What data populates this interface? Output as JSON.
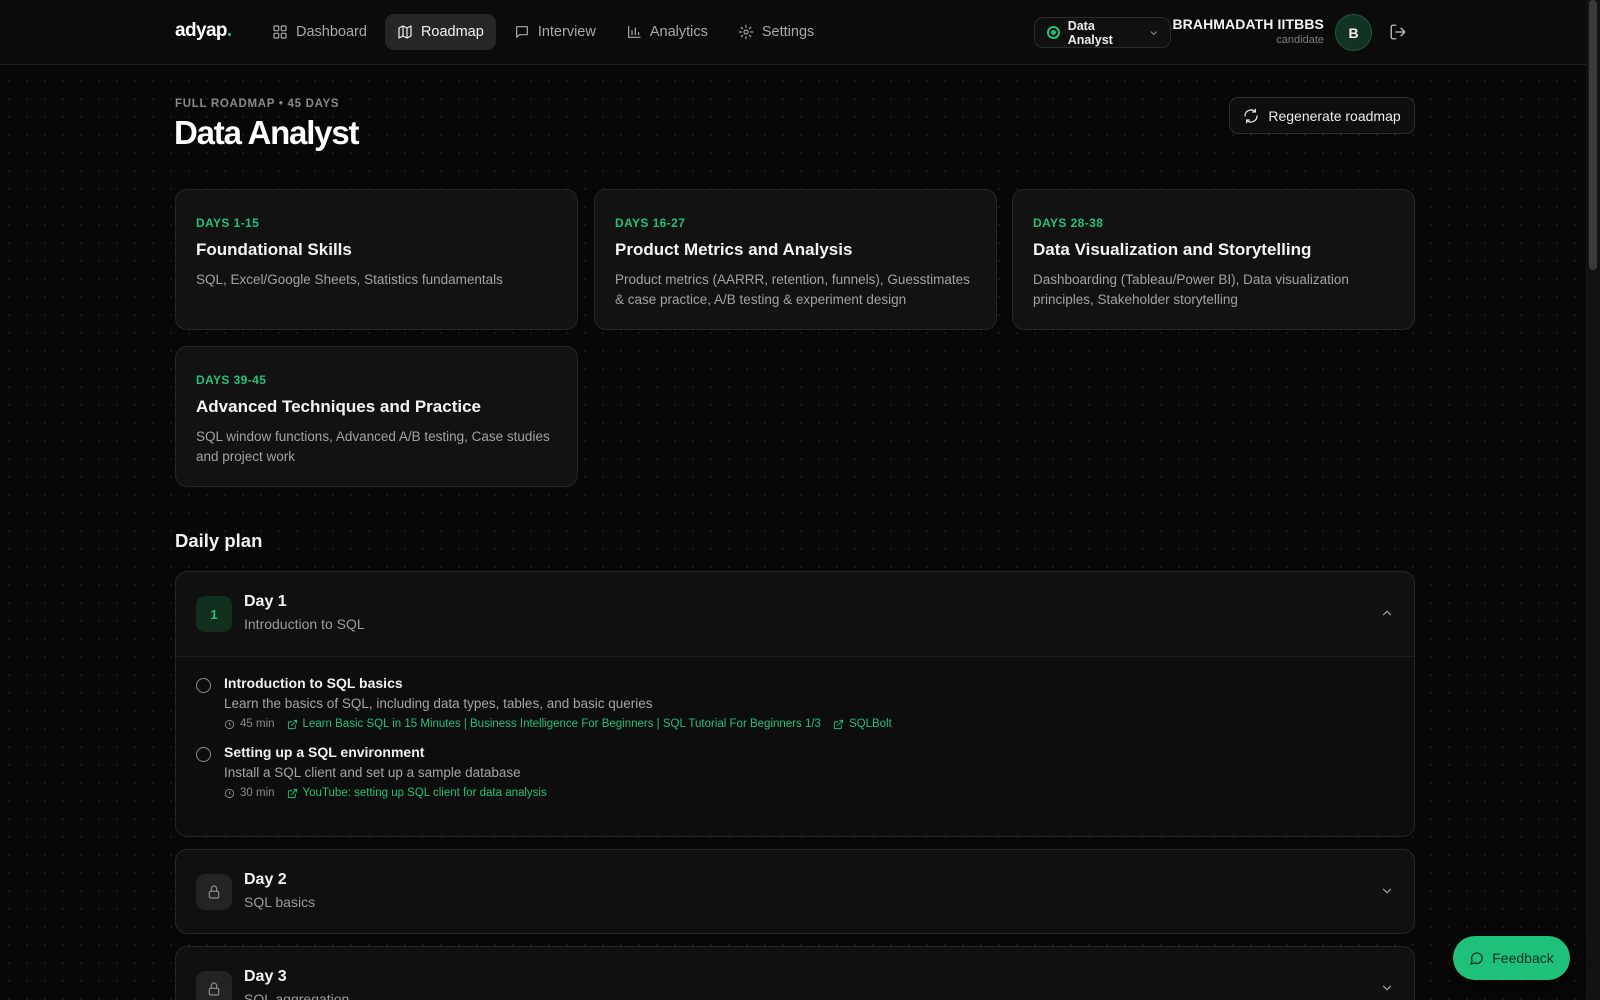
{
  "app": {
    "logo_text": "adyap",
    "logo_dot": "."
  },
  "nav": {
    "items": [
      {
        "label": "Dashboard",
        "icon": "grid-icon"
      },
      {
        "label": "Roadmap",
        "icon": "map-icon",
        "active": true
      },
      {
        "label": "Interview",
        "icon": "chat-icon"
      },
      {
        "label": "Analytics",
        "icon": "bar-chart-icon"
      },
      {
        "label": "Settings",
        "icon": "gear-icon"
      }
    ]
  },
  "role_selector": {
    "value": "Data Analyst"
  },
  "user": {
    "name": "BRAHMADATH IITBBS",
    "role": "candidate",
    "initial": "B"
  },
  "header": {
    "eyebrow": "FULL ROADMAP • 45 DAYS",
    "title": "Data Analyst",
    "regenerate_label": "Regenerate roadmap"
  },
  "phases": [
    {
      "days": "DAYS 1-15",
      "title": "Foundational Skills",
      "desc": "SQL, Excel/Google Sheets, Statistics fundamentals"
    },
    {
      "days": "DAYS 16-27",
      "title": "Product Metrics and Analysis",
      "desc": "Product metrics (AARRR, retention, funnels), Guesstimates & case practice, A/B testing & experiment design"
    },
    {
      "days": "DAYS 28-38",
      "title": "Data Visualization and Storytelling",
      "desc": "Dashboarding (Tableau/Power BI), Data visualization principles, Stakeholder storytelling"
    },
    {
      "days": "DAYS 39-45",
      "title": "Advanced Techniques and Practice",
      "desc": "SQL window functions, Advanced A/B testing, Case studies and project work"
    }
  ],
  "daily_plan": {
    "title": "Daily plan",
    "days": [
      {
        "badge": "1",
        "title": "Day 1",
        "subtitle": "Introduction to SQL",
        "tasks": [
          {
            "title": "Introduction to SQL basics",
            "desc": "Learn the basics of SQL, including data types, tables, and basic queries",
            "time": "45 min",
            "links": [
              "Learn Basic SQL in 15 Minutes | Business Intelligence For Beginners | SQL Tutorial For Beginners 1/3",
              "SQLBolt"
            ]
          },
          {
            "title": "Setting up a SQL environment",
            "desc": "Install a SQL client and set up a sample database",
            "time": "30 min",
            "links": [
              "YouTube: setting up SQL client for data analysis"
            ]
          }
        ]
      },
      {
        "title": "Day 2",
        "subtitle": "SQL basics"
      },
      {
        "title": "Day 3",
        "subtitle": "SQL aggregation"
      }
    ]
  },
  "feedback_label": "Feedback",
  "colors": {
    "accent": "#22c17a",
    "background": "#070707",
    "card": "#121212"
  }
}
